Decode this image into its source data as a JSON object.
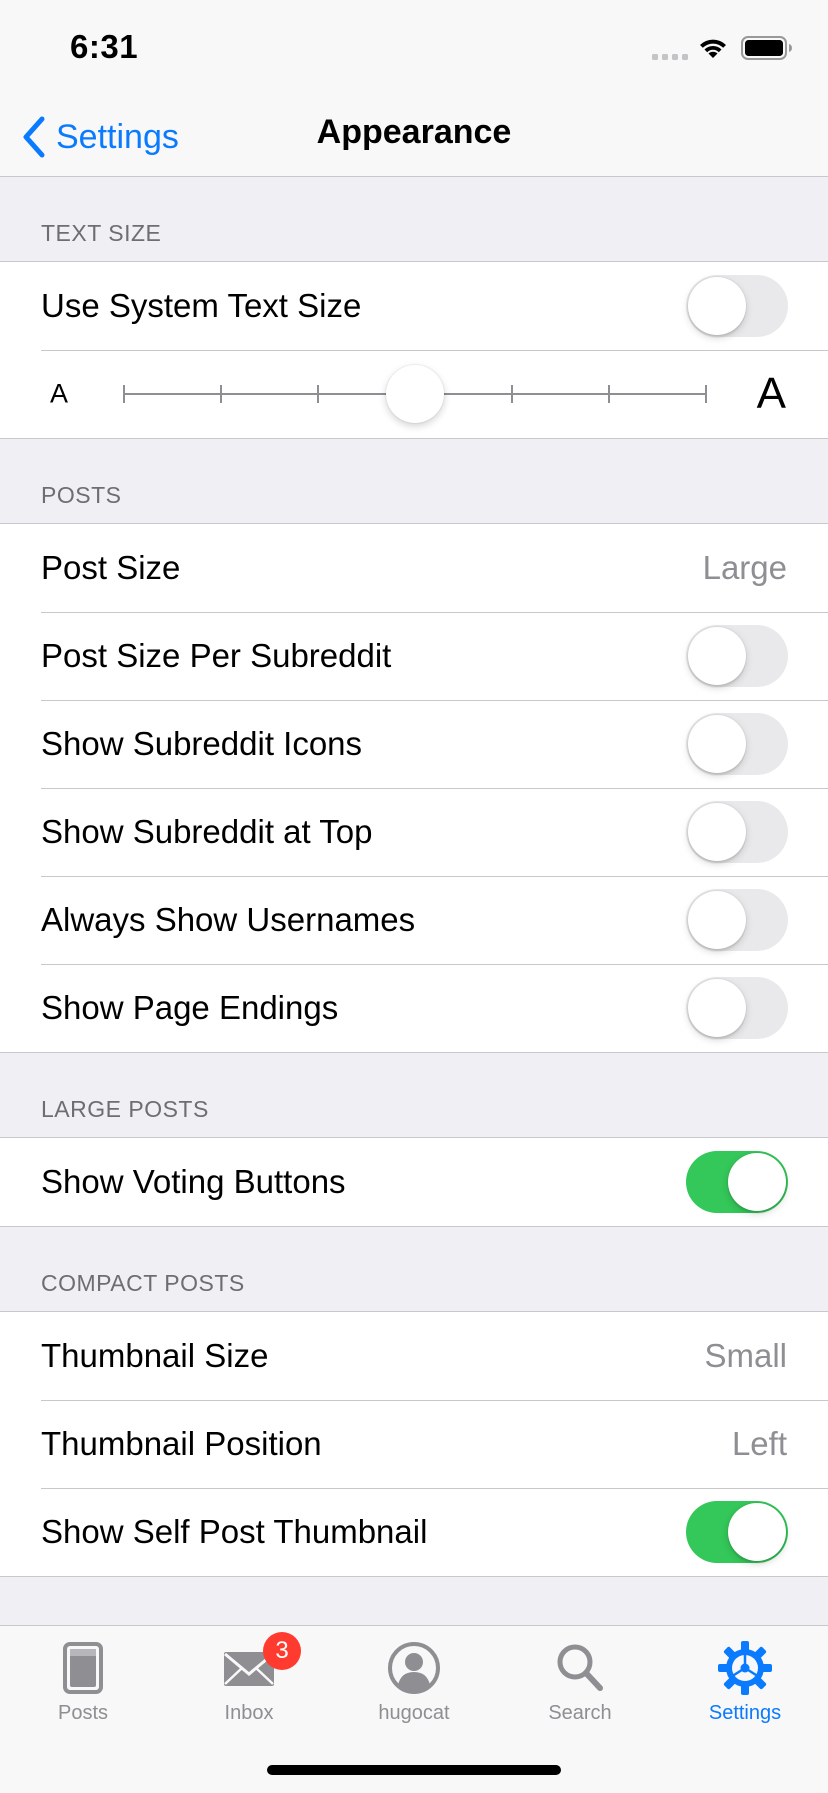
{
  "status_bar": {
    "time": "6:31"
  },
  "nav": {
    "back_label": "Settings",
    "title": "Appearance"
  },
  "sections": {
    "text_size": {
      "header": "TEXT SIZE",
      "use_system_text_size": {
        "label": "Use System Text Size",
        "on": false
      },
      "slider": {
        "small_label": "A",
        "large_label": "A",
        "steps": 7,
        "selected_step": 3
      }
    },
    "posts": {
      "header": "POSTS",
      "post_size": {
        "label": "Post Size",
        "value": "Large"
      },
      "toggles": [
        {
          "label": "Post Size Per Subreddit",
          "on": false
        },
        {
          "label": "Show Subreddit Icons",
          "on": false
        },
        {
          "label": "Show Subreddit at Top",
          "on": false
        },
        {
          "label": "Always Show Usernames",
          "on": false
        },
        {
          "label": "Show Page Endings",
          "on": false
        }
      ]
    },
    "large_posts": {
      "header": "LARGE POSTS",
      "show_voting_buttons": {
        "label": "Show Voting Buttons",
        "on": true
      }
    },
    "compact_posts": {
      "header": "COMPACT POSTS",
      "thumbnail_size": {
        "label": "Thumbnail Size",
        "value": "Small"
      },
      "thumbnail_position": {
        "label": "Thumbnail Position",
        "value": "Left"
      },
      "show_self_post_thumbnail": {
        "label": "Show Self Post Thumbnail",
        "on": true
      }
    }
  },
  "tab_bar": {
    "tabs": [
      {
        "label": "Posts",
        "icon": "posts-icon"
      },
      {
        "label": "Inbox",
        "icon": "envelope-icon",
        "badge": "3"
      },
      {
        "label": "hugocat",
        "icon": "account-icon"
      },
      {
        "label": "Search",
        "icon": "search-icon"
      },
      {
        "label": "Settings",
        "icon": "gear-icon",
        "active": true
      }
    ]
  },
  "colors": {
    "accent": "#0a7aff",
    "toggle_on": "#34c759",
    "toggle_off": "#e9e9eb",
    "badge": "#ff3b30",
    "grouped_background": "#efeff4"
  }
}
